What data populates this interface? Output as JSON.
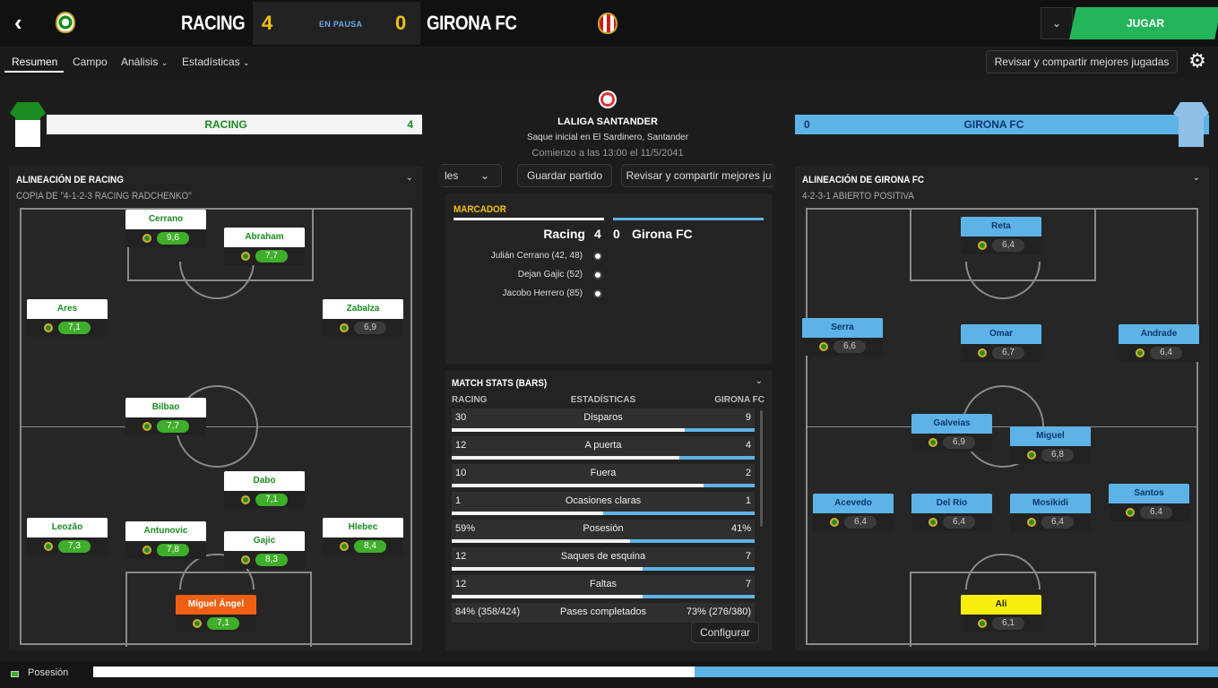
{
  "header": {
    "home_team": "RACING",
    "home_score": "4",
    "status": "EN PAUSA",
    "away_score": "0",
    "away_team": "GIRONA FC",
    "play_button": "JUGAR",
    "dropdown_icon": "chevron-down-icon"
  },
  "nav": {
    "tabs": [
      "Resumen",
      "Campo",
      "Análisis",
      "Estadísticas"
    ],
    "active_tab": "Resumen",
    "share_button": "Revisar y compartir mejores jugadas"
  },
  "home_kit": {
    "team": "RACING",
    "score": "4"
  },
  "away_kit": {
    "team": "GIRONA FC",
    "score": "0"
  },
  "home_lineup": {
    "title": "ALINEACIÓN DE RACING",
    "subtitle": "COPIA DE \"4-1-2-3 RACING RADCHENKO\"",
    "players": [
      {
        "name": "Cerrano",
        "rating": "9,6"
      },
      {
        "name": "Abraham",
        "rating": "7,7"
      },
      {
        "name": "Ares",
        "rating": "7,1"
      },
      {
        "name": "Zabalza",
        "rating": "6,9"
      },
      {
        "name": "Bilbao",
        "rating": "7,7"
      },
      {
        "name": "Dabo",
        "rating": "7,1"
      },
      {
        "name": "Leozão",
        "rating": "7,3"
      },
      {
        "name": "Antunovic",
        "rating": "7,8"
      },
      {
        "name": "Gajic",
        "rating": "8,3"
      },
      {
        "name": "Hlebec",
        "rating": "8,4"
      },
      {
        "name": "Miguel Ángel",
        "rating": "7,1"
      }
    ]
  },
  "away_lineup": {
    "title": "ALINEACIÓN DE GIRONA FC",
    "subtitle": "4-2-3-1 ABIERTO POSITIVA",
    "players": [
      {
        "name": "Reta",
        "rating": "6,4"
      },
      {
        "name": "Serra",
        "rating": "6,6"
      },
      {
        "name": "Omar",
        "rating": "6,7"
      },
      {
        "name": "Andrade",
        "rating": "6,4"
      },
      {
        "name": "Galveias",
        "rating": "6,9"
      },
      {
        "name": "Miguel",
        "rating": "6,8"
      },
      {
        "name": "Acevedo",
        "rating": "6,4"
      },
      {
        "name": "Del Rio",
        "rating": "6,4"
      },
      {
        "name": "Mosikidi",
        "rating": "6,4"
      },
      {
        "name": "Santos",
        "rating": "6,4"
      },
      {
        "name": "Ali",
        "rating": "6,1"
      }
    ]
  },
  "match_info": {
    "competition": "LALIGA SANTANDER",
    "venue": "Saque inicial en El Sardinero, Santander",
    "time": "Comienzo a las 13:00 el 11/5/2041",
    "les_button": "les",
    "save_button": "Guardar partido",
    "share_button": "Revisar y compartir mejores ju"
  },
  "scoreboard": {
    "title": "MARCADOR",
    "home": "Racing",
    "home_score": "4",
    "away_score": "0",
    "away": "Girona FC",
    "goals": [
      "Julián Cerrano (42, 48)",
      "Dejan Gajic (52)",
      "Jacobo Herrero (85)"
    ]
  },
  "stats": {
    "title": "MATCH STATS (BARS)",
    "col_home": "RACING",
    "col_label": "ESTADÍSTICAS",
    "col_away": "GIRONA FC",
    "rows": [
      {
        "label": "Disparos",
        "home": "30",
        "away": "9",
        "home_share": 0.77
      },
      {
        "label": "A puerta",
        "home": "12",
        "away": "4",
        "home_share": 0.75
      },
      {
        "label": "Fuera",
        "home": "10",
        "away": "2",
        "home_share": 0.83
      },
      {
        "label": "Ocasiones claras",
        "home": "1",
        "away": "1",
        "home_share": 0.5
      },
      {
        "label": "Posesión",
        "home": "59%",
        "away": "41%",
        "home_share": 0.59
      },
      {
        "label": "Saques de esquina",
        "home": "12",
        "away": "7",
        "home_share": 0.63
      },
      {
        "label": "Faltas",
        "home": "12",
        "away": "7",
        "home_share": 0.63
      },
      {
        "label": "Pases completados",
        "home": "84% (358/424)",
        "away": "73% (276/380)",
        "home_share": null
      }
    ],
    "configure_button": "Configurar"
  },
  "possession": {
    "label": "Posesión",
    "home_share": 0.535
  },
  "colors": {
    "home": "#ffffff",
    "away": "#5db3e6",
    "accent_green": "#24b45a",
    "score_yellow": "#f4c20d"
  }
}
